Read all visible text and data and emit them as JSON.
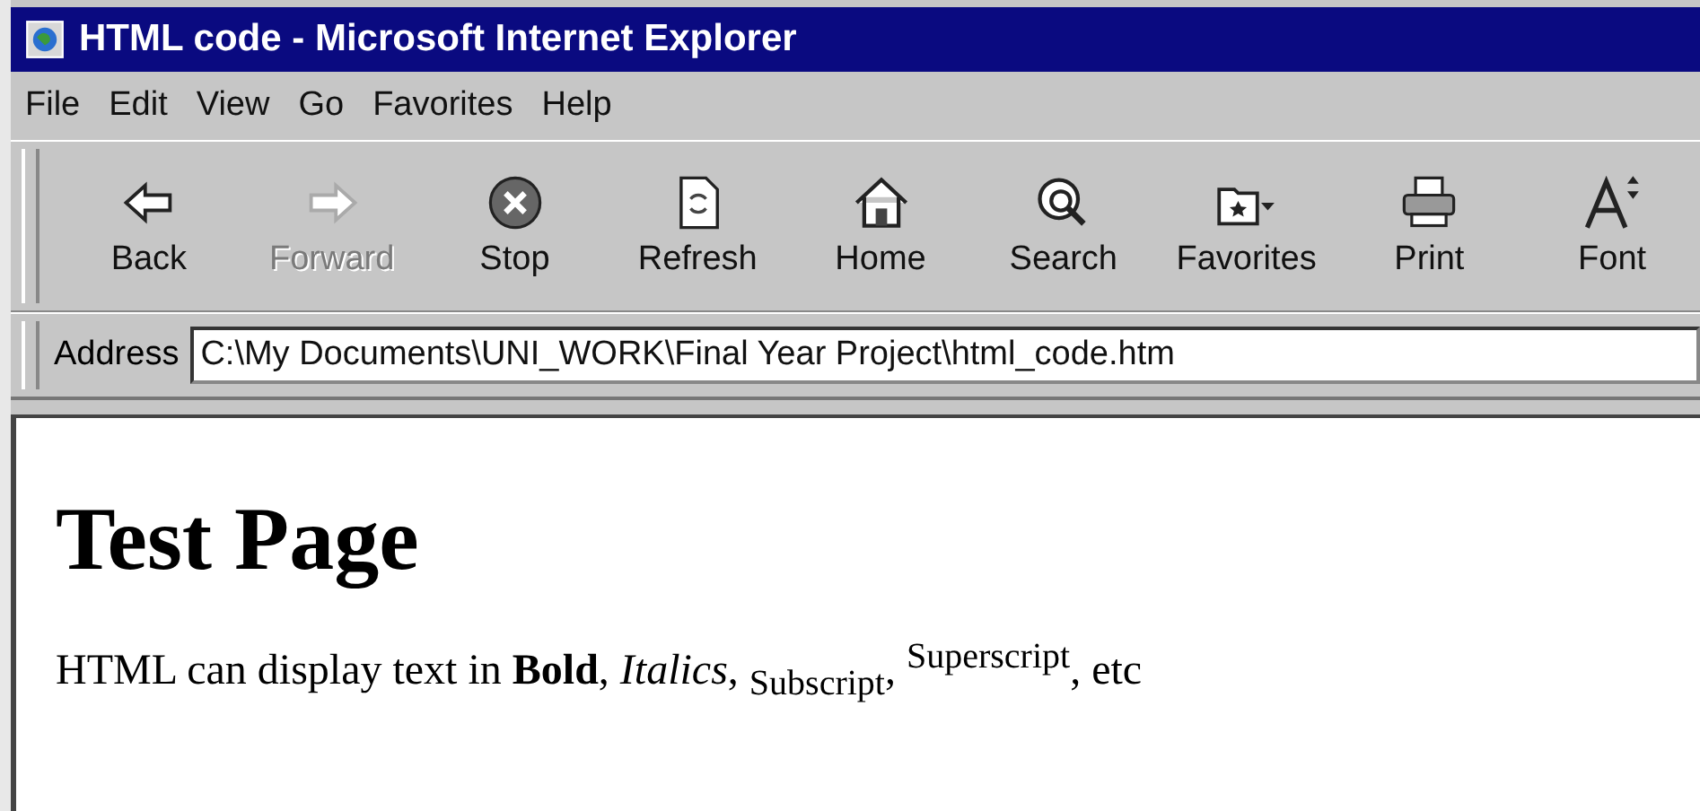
{
  "window": {
    "title": "HTML code - Microsoft Internet Explorer"
  },
  "menu": [
    "File",
    "Edit",
    "View",
    "Go",
    "Favorites",
    "Help"
  ],
  "toolbar": [
    {
      "kind": "back",
      "label": "Back",
      "disabled": false
    },
    {
      "kind": "forward",
      "label": "Forward",
      "disabled": true
    },
    {
      "kind": "stop",
      "label": "Stop",
      "disabled": false
    },
    {
      "kind": "refresh",
      "label": "Refresh",
      "disabled": false
    },
    {
      "kind": "home",
      "label": "Home",
      "disabled": false
    },
    {
      "kind": "search",
      "label": "Search",
      "disabled": false
    },
    {
      "kind": "favorites",
      "label": "Favorites",
      "disabled": false
    },
    {
      "kind": "print",
      "label": "Print",
      "disabled": false
    },
    {
      "kind": "font",
      "label": "Font",
      "disabled": false
    }
  ],
  "address": {
    "label": "Address",
    "value": "C:\\My Documents\\UNI_WORK\\Final Year Project\\html_code.htm"
  },
  "page": {
    "heading": "Test Page",
    "text": "HTML can display text in **Bold**, *Italics*, $_{Subscript}$, $^{Superscript}$, etc"
  }
}
